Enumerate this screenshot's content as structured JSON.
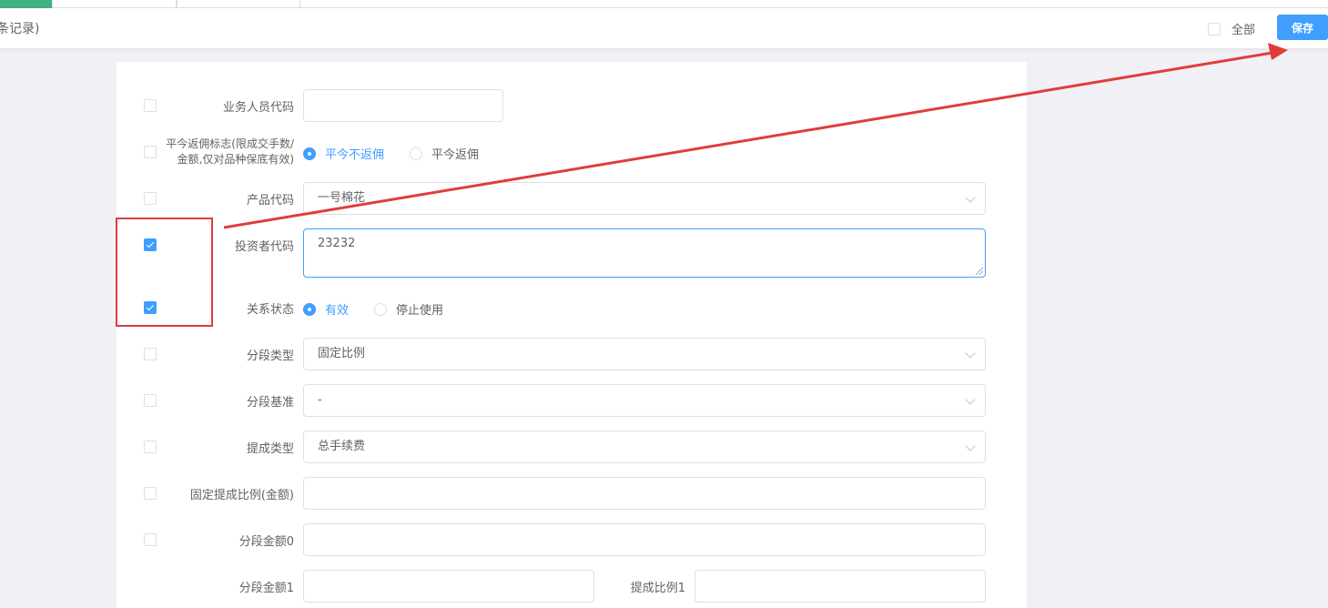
{
  "header": {
    "title": "条记录)",
    "all_label": "全部",
    "all_checked": false,
    "save_label": "保存"
  },
  "form": {
    "rows": [
      {
        "label": "业务人员代码",
        "checked": false,
        "value": ""
      },
      {
        "label_line1": "平今返佣标志(限成交手数/",
        "label_line2": "金额,仅对品种保底有效)",
        "checked": false,
        "options": [
          "平今不返佣",
          "平今返佣"
        ],
        "selected": "平今不返佣"
      },
      {
        "label": "产品代码",
        "checked": false,
        "value": "一号棉花"
      },
      {
        "label": "投资者代码",
        "checked": true,
        "value": "23232"
      },
      {
        "label": "关系状态",
        "checked": true,
        "options": [
          "有效",
          "停止使用"
        ],
        "selected": "有效"
      },
      {
        "label": "分段类型",
        "checked": false,
        "value": "固定比例"
      },
      {
        "label": "分段基准",
        "checked": false,
        "value": "-"
      },
      {
        "label": "提成类型",
        "checked": false,
        "value": "总手续费"
      },
      {
        "label": "固定提成比例(金额)",
        "checked": false,
        "value": ""
      },
      {
        "label": "分段金额0",
        "checked": false,
        "value": ""
      },
      {
        "label": "分段金额1",
        "value": "",
        "label_right": "提成比例1",
        "value_right": ""
      }
    ]
  },
  "colors": {
    "accent": "#409eff",
    "active_tab": "#3fb27f",
    "annotation": "#e23b3b"
  }
}
